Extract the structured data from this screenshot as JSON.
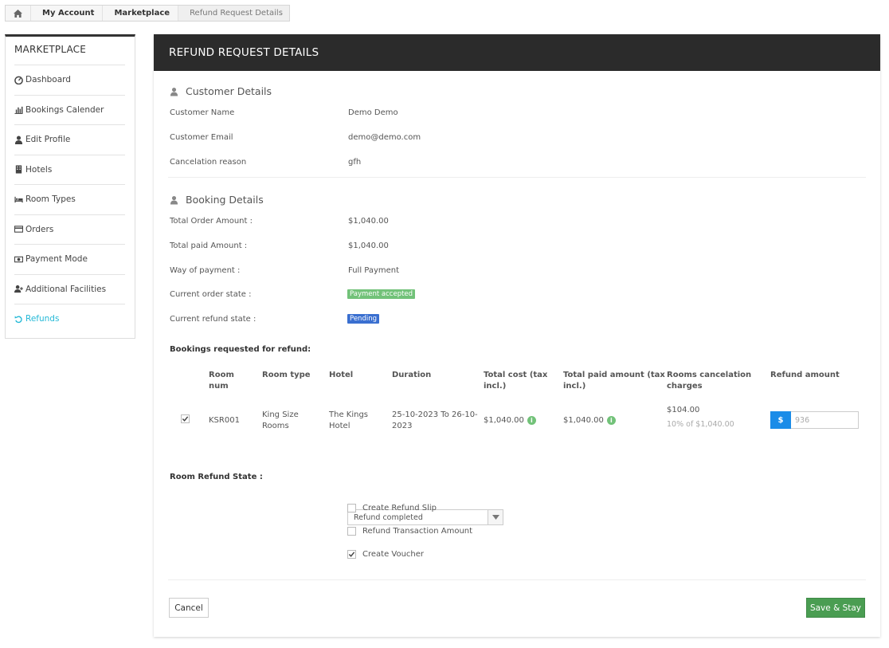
{
  "breadcrumb": {
    "items": [
      "My Account",
      "Marketplace",
      "Refund Request Details"
    ]
  },
  "sidebar": {
    "title": "MARKETPLACE",
    "items": [
      {
        "label": "Dashboard",
        "icon": "dashboard-icon"
      },
      {
        "label": "Bookings Calender",
        "icon": "bar-chart-icon"
      },
      {
        "label": "Edit Profile",
        "icon": "user-icon"
      },
      {
        "label": "Hotels",
        "icon": "building-icon"
      },
      {
        "label": "Room Types",
        "icon": "bed-icon"
      },
      {
        "label": "Orders",
        "icon": "credit-card-icon"
      },
      {
        "label": "Payment Mode",
        "icon": "money-icon"
      },
      {
        "label": "Additional Facilities",
        "icon": "user-plus-icon"
      },
      {
        "label": "Refunds",
        "icon": "undo-icon",
        "active": true
      }
    ],
    "active_color": "#25b9d7"
  },
  "panel": {
    "title": "REFUND REQUEST DETAILS",
    "customer": {
      "title": "Customer Details",
      "rows": [
        {
          "label": "Customer Name",
          "value": "Demo Demo"
        },
        {
          "label": "Customer Email",
          "value": "demo@demo.com"
        },
        {
          "label": "Cancelation reason",
          "value": "gfh"
        }
      ]
    },
    "booking": {
      "title": "Booking Details",
      "rows": [
        {
          "label": "Total Order Amount :",
          "value": "$1,040.00"
        },
        {
          "label": "Total paid Amount :",
          "value": "$1,040.00"
        },
        {
          "label": "Way of payment :",
          "value": "Full Payment"
        },
        {
          "label": "Current order state :",
          "value": "Payment accepted"
        },
        {
          "label": "Current refund state :",
          "value": "Pending"
        }
      ]
    },
    "refund_table": {
      "title": "Bookings requested for refund:",
      "headers": {
        "room_num": [
          "Room",
          "num"
        ],
        "room_type": "Room type",
        "hotel": "Hotel",
        "duration": "Duration",
        "total_cost": [
          "Total cost (tax",
          "incl.)"
        ],
        "total_paid": [
          "Total paid amount (tax",
          "incl.)"
        ],
        "cancel_charges": [
          "Rooms cancelation",
          "charges"
        ],
        "refund_amount": "Refund amount"
      },
      "row": {
        "checked": true,
        "room_num": "KSR001",
        "room_type": [
          "King Size",
          "Rooms"
        ],
        "hotel": [
          "The Kings",
          "Hotel"
        ],
        "duration": [
          "25-10-2023 To 26-10-",
          "2023"
        ],
        "total_cost": "$1,040.00",
        "total_paid": "$1,040.00",
        "cancel_charge": "$104.00",
        "cancel_note": "10% of $1,040.00",
        "currency": "$",
        "refund_value": "936"
      }
    },
    "room_refund_state": {
      "label": "Room Refund State :",
      "selected": "Refund completed",
      "options": [
        {
          "label": "Create Refund Slip",
          "checked": false
        },
        {
          "label": "Refund Transaction Amount",
          "checked": false
        },
        {
          "label": "Create Voucher",
          "checked": true
        }
      ]
    },
    "buttons": {
      "cancel": "Cancel",
      "save": "Save & Stay"
    }
  }
}
